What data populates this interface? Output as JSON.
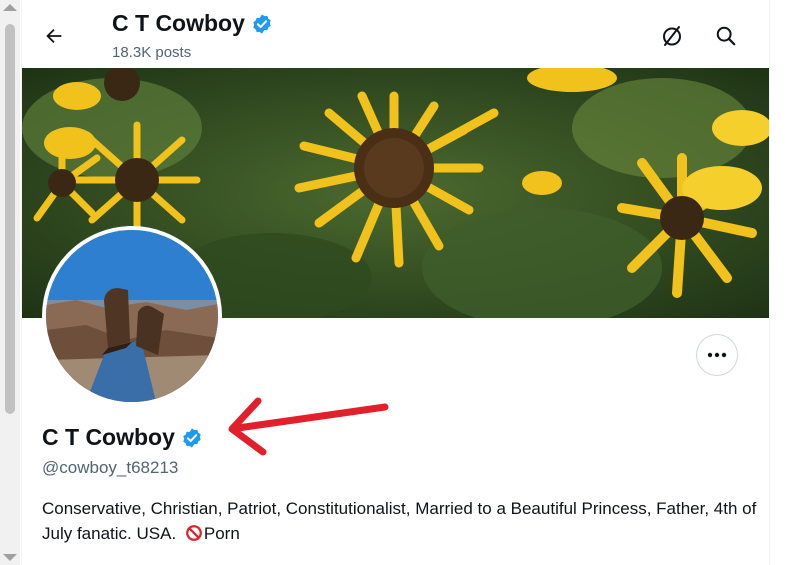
{
  "header": {
    "name": "C T Cowboy",
    "posts": "18.3K posts"
  },
  "profile": {
    "name": "C T Cowboy",
    "handle": "@cowboy_t68213",
    "bio": "Conservative, Christian, Patriot, Constitutionalist, Married to a Beautiful Princess, Father, 4th of July fanatic.  USA. ",
    "bio_tail": "Porn"
  },
  "colors": {
    "verified": "#1d9bf0",
    "annotation_arrow": "#e0202a",
    "no_symbol": "#e0202a"
  },
  "icons": {
    "back": "arrow-left-icon",
    "grok": "slash-circle-icon",
    "search": "search-icon",
    "more": "more-dots-icon",
    "verified": "verified-badge-icon"
  }
}
